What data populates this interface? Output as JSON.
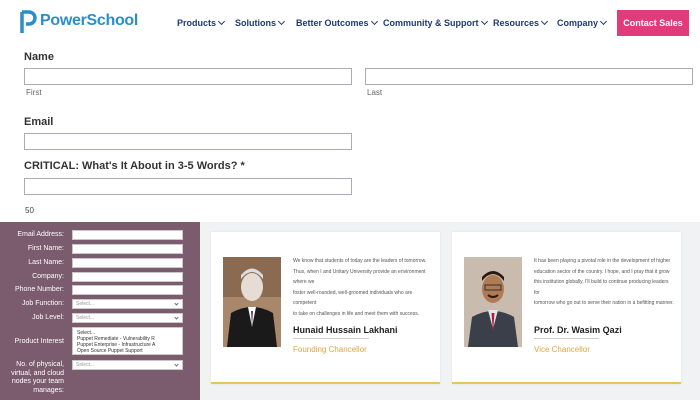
{
  "header": {
    "logo_text": "PowerSchool",
    "nav": [
      {
        "label": "Products"
      },
      {
        "label": "Solutions"
      },
      {
        "label": "Better Outcomes"
      },
      {
        "label": "Community & Support"
      },
      {
        "label": "Resources"
      },
      {
        "label": "Company"
      }
    ],
    "cta_label": "Contact Sales",
    "accent": "#e03c7b",
    "nav_color": "#1e3a73"
  },
  "top_form": {
    "name_label": "Name",
    "first_label": "First",
    "last_label": "Last",
    "email_label": "Email",
    "critical_label": "CRITICAL: What's It About in 3-5 Words? *",
    "counter": "50"
  },
  "side_form": {
    "bg": "#7b5b6e",
    "fields": [
      {
        "label": "Email Address:"
      },
      {
        "label": "First Name:"
      },
      {
        "label": "Last Name:"
      },
      {
        "label": "Company:"
      },
      {
        "label": "Phone Number:"
      }
    ],
    "job_function": {
      "label": "Job Function:",
      "placeholder": "Select..."
    },
    "job_level": {
      "label": "Job Level:",
      "placeholder": "Select..."
    },
    "product_interest": {
      "label": "Product Interest",
      "options": [
        "Select...",
        "Puppet Remediate - Vulnerability R",
        "Puppet Enterprise - Infrastructure A",
        "Open Source Puppet Support"
      ]
    },
    "nodes": {
      "label_lines": [
        "No. of physical,",
        "virtual, and cloud",
        "nodes your team",
        "manages:"
      ],
      "placeholder": "Select..."
    }
  },
  "cards": [
    {
      "quote": [
        "We know that students of today are the leaders of tomorrow.",
        "Thus, when I and Unitary University provide an environment where we",
        "foster well-rounded, well-groomed individuals who are competent",
        "to take on challenges in life and meet them with success."
      ],
      "name": "Hunaid Hussain Lakhani",
      "role": "Founding Chancellor"
    },
    {
      "quote": [
        "It has been playing a pivotal role in the development of higher",
        "education sector of the country. I hope, and I pray that it grow",
        "this institution globally, I'll build to continue producing leaders for",
        "tomorrow who go out to serve their nation in a befitting manner."
      ],
      "name": "Prof. Dr. Wasim Qazi",
      "role": "Vice Chancellor"
    }
  ]
}
